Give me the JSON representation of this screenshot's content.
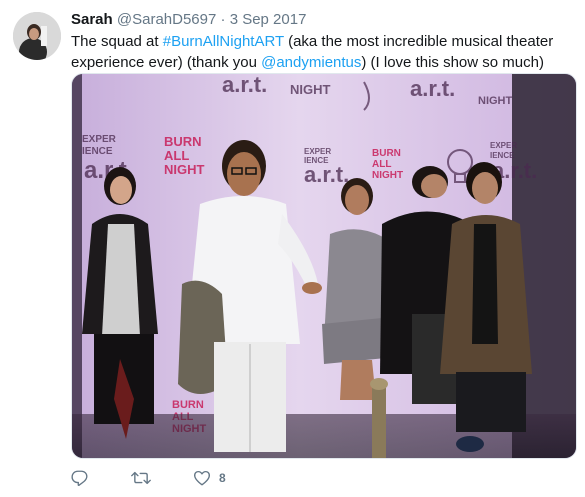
{
  "tweet": {
    "author_name": "Sarah",
    "author_handle": "@SarahD5697",
    "separator": "·",
    "date": "3 Sep 2017",
    "text_part1": "The squad at ",
    "hashtag": "#BurnAllNightART",
    "text_part2": " (aka the most incredible musical theater experience ever) (thank you ",
    "mention": "@andymientus",
    "text_part3": ") (I love this show so much)"
  },
  "photo": {
    "backdrop_logos": {
      "experience_art": "EXPERIENCE a.r.t.",
      "burn_all_night": "BURN ALL NIGHT"
    }
  },
  "actions": {
    "reply_icon": "reply-icon",
    "retweet_icon": "retweet-icon",
    "like_icon": "heart-icon",
    "like_count": "8"
  },
  "colors": {
    "link": "#1da1f2",
    "muted": "#657786",
    "text": "#14171a",
    "backdrop": "#d7c2e3"
  }
}
